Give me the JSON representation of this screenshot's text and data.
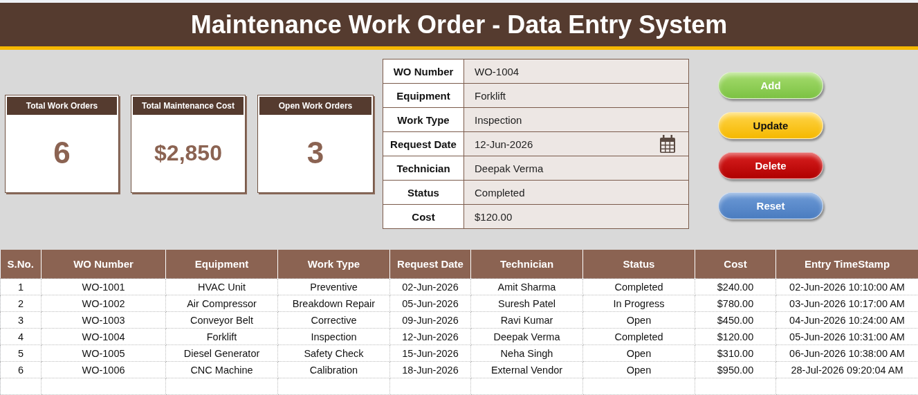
{
  "title": "Maintenance Work Order - Data Entry System",
  "kpis": [
    {
      "label": "Total Work Orders",
      "value": "6"
    },
    {
      "label": "Total Maintenance Cost",
      "value": "$2,850"
    },
    {
      "label": "Open Work Orders",
      "value": "3"
    }
  ],
  "form": [
    {
      "label": "WO Number",
      "value": "WO-1004"
    },
    {
      "label": "Equipment",
      "value": "Forklift"
    },
    {
      "label": "Work Type",
      "value": "Inspection"
    },
    {
      "label": "Request Date",
      "value": "12-Jun-2026",
      "kind": "date"
    },
    {
      "label": "Technician",
      "value": "Deepak Verma"
    },
    {
      "label": "Status",
      "value": "Completed"
    },
    {
      "label": "Cost",
      "value": "$120.00"
    }
  ],
  "buttons": [
    {
      "label": "Add",
      "kind": "add"
    },
    {
      "label": "Update",
      "kind": "update"
    },
    {
      "label": "Delete",
      "kind": "delete"
    },
    {
      "label": "Reset",
      "kind": "reset"
    }
  ],
  "table": {
    "columns": [
      "S.No.",
      "WO Number",
      "Equipment",
      "Work Type",
      "Request Date",
      "Technician",
      "Status",
      "Cost",
      "Entry TimeStamp"
    ],
    "rows": [
      [
        "1",
        "WO-1001",
        "HVAC Unit",
        "Preventive",
        "02-Jun-2026",
        "Amit Sharma",
        "Completed",
        "$240.00",
        "02-Jun-2026 10:10:00 AM"
      ],
      [
        "2",
        "WO-1002",
        "Air Compressor",
        "Breakdown Repair",
        "05-Jun-2026",
        "Suresh Patel",
        "In Progress",
        "$780.00",
        "03-Jun-2026 10:17:00 AM"
      ],
      [
        "3",
        "WO-1003",
        "Conveyor Belt",
        "Corrective",
        "09-Jun-2026",
        "Ravi Kumar",
        "Open",
        "$450.00",
        "04-Jun-2026 10:24:00 AM"
      ],
      [
        "4",
        "WO-1004",
        "Forklift",
        "Inspection",
        "12-Jun-2026",
        "Deepak Verma",
        "Completed",
        "$120.00",
        "05-Jun-2026 10:31:00 AM"
      ],
      [
        "5",
        "WO-1005",
        "Diesel Generator",
        "Safety Check",
        "15-Jun-2026",
        "Neha Singh",
        "Open",
        "$310.00",
        "06-Jun-2026 10:38:00 AM"
      ],
      [
        "6",
        "WO-1006",
        "CNC Machine",
        "Calibration",
        "18-Jun-2026",
        "External Vendor",
        "Open",
        "$950.00",
        "28-Jul-2026 09:20:04 AM"
      ]
    ]
  }
}
